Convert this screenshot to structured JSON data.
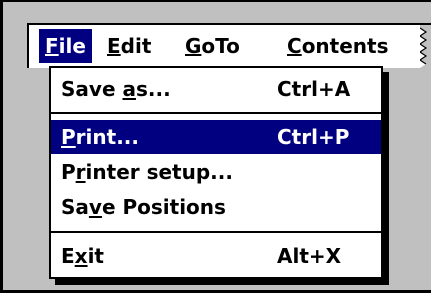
{
  "menubar": {
    "items": [
      {
        "label_pre": "",
        "mnemonic": "F",
        "label_post": "ile",
        "active": true
      },
      {
        "label_pre": "",
        "mnemonic": "E",
        "label_post": "dit",
        "active": false
      },
      {
        "label_pre": "",
        "mnemonic": "G",
        "label_post": "oTo",
        "active": false
      },
      {
        "label_pre": "",
        "mnemonic": "C",
        "label_post": "ontents",
        "active": false
      }
    ]
  },
  "file_menu": {
    "items": [
      {
        "pre": "Save ",
        "mn": "a",
        "post": "s...",
        "accel": "Ctrl+A"
      },
      {
        "pre": "",
        "mn": "P",
        "post": "rint...",
        "accel": "Ctrl+P",
        "selected": true
      },
      {
        "pre": "P",
        "mn": "r",
        "post": "inter setup...",
        "accel": ""
      },
      {
        "pre": "Sa",
        "mn": "v",
        "post": "e Positions",
        "accel": ""
      },
      {
        "pre": "E",
        "mn": "x",
        "post": "it",
        "accel": "Alt+X"
      }
    ]
  },
  "colors": {
    "highlight": "#000080",
    "background": "#c0c0c0",
    "menu_bg": "#ffffff"
  }
}
